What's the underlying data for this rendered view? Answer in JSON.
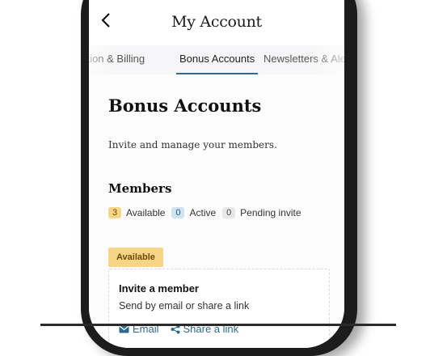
{
  "header": {
    "title": "My Account"
  },
  "tabs": [
    {
      "label": "Subscription & Billing"
    },
    {
      "label": "Bonus Accounts"
    },
    {
      "label": "Newsletters & Alerts"
    }
  ],
  "page": {
    "title": "Bonus Accounts",
    "description": "Invite and manage your members."
  },
  "members": {
    "heading": "Members",
    "stats": [
      {
        "count": "3",
        "label": "Available"
      },
      {
        "count": "0",
        "label": "Active"
      },
      {
        "count": "0",
        "label": "Pending invite"
      }
    ]
  },
  "slot": {
    "tag": "Available",
    "card_title": "Invite a member",
    "card_subtitle": "Send by email or share a link",
    "email_label": "Email",
    "share_label": "Share a link"
  },
  "colors": {
    "accent": "#2f6a8d",
    "available": "#f6d587",
    "active": "#cfe3f1"
  },
  "icons": [
    "back-chevron-icon",
    "mail-icon",
    "share-icon"
  ]
}
